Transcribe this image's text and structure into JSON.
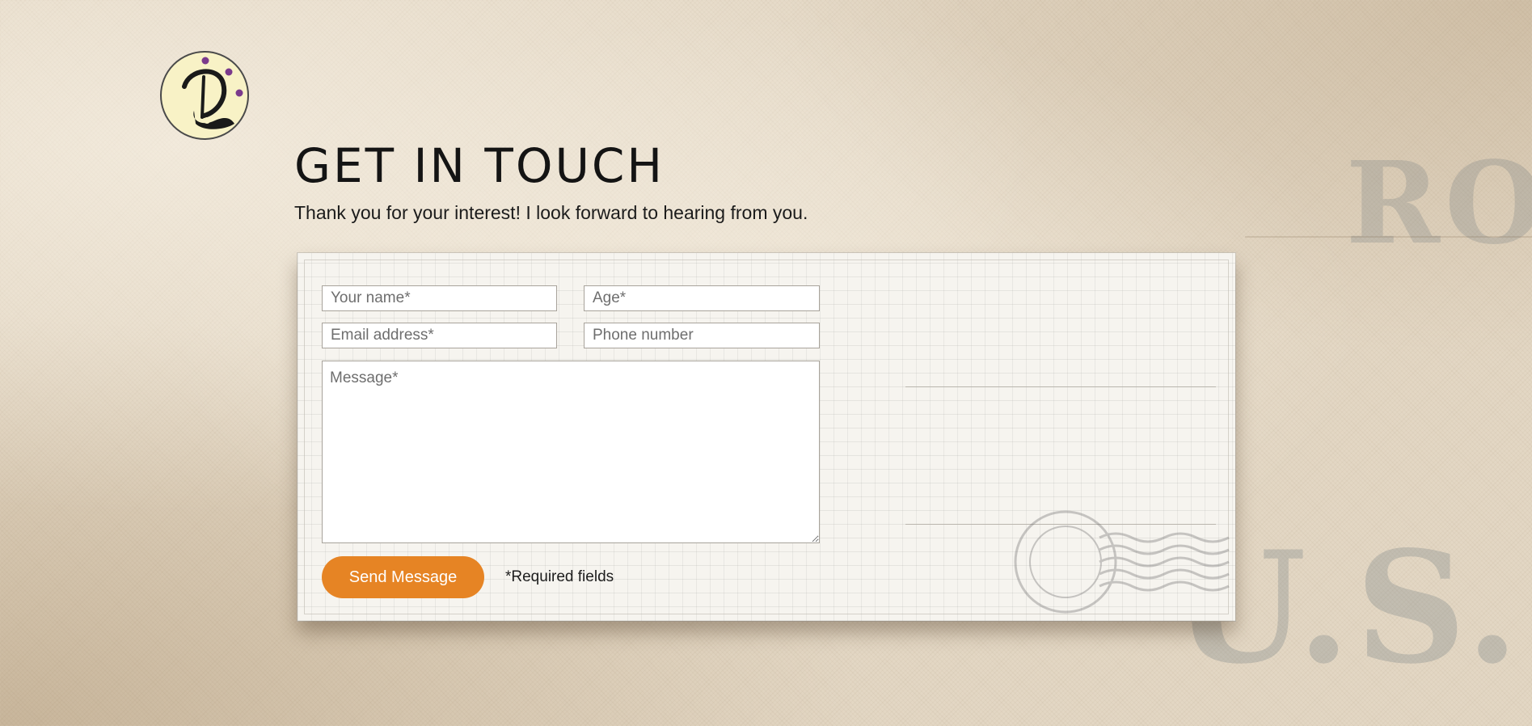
{
  "header": {
    "logo_name": "circular-script-d-logo"
  },
  "main": {
    "title": "GET IN TOUCH",
    "subtitle": "Thank you for your interest! I look forward to hearing from you."
  },
  "form": {
    "name_placeholder": "Your name*",
    "age_placeholder": "Age*",
    "email_placeholder": "Email address*",
    "phone_placeholder": "Phone number",
    "message_placeholder": "Message*",
    "submit_label": "Send Message",
    "required_note": "*Required fields"
  },
  "colors": {
    "accent": "#e68424",
    "logo_fill": "#f8f2c6",
    "logo_dots": "#7b3a8c",
    "background": "#e3d7c4",
    "text": "#141414"
  }
}
